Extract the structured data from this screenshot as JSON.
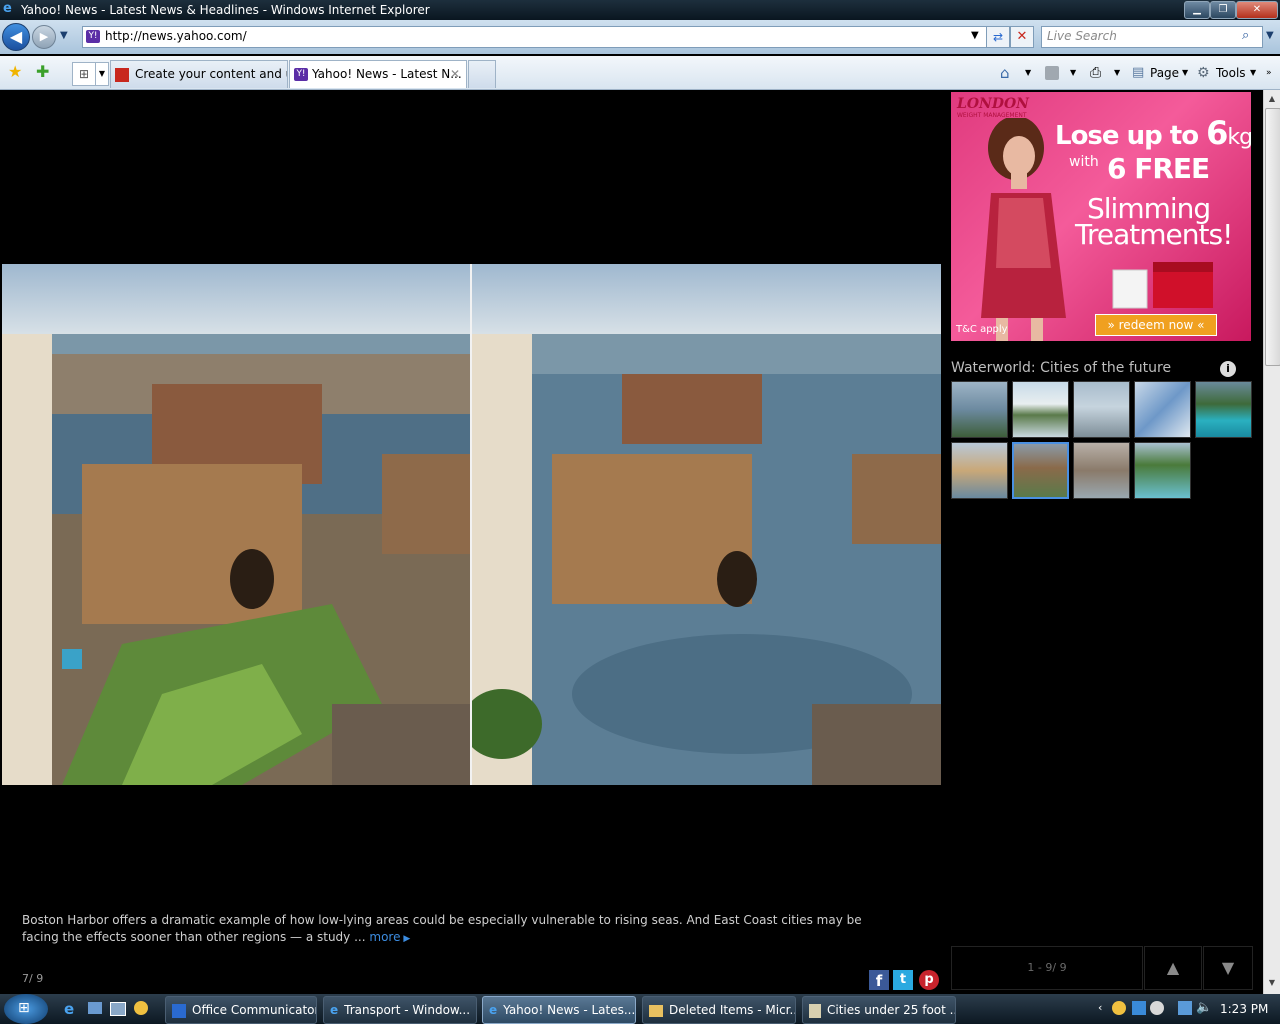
{
  "window": {
    "title": "Yahoo! News - Latest News & Headlines - Windows Internet Explorer"
  },
  "address_bar": {
    "url": "http://news.yahoo.com/",
    "search_placeholder": "Live Search"
  },
  "tabs": [
    {
      "label": "Create your content and u..."
    },
    {
      "label": "Yahoo! News - Latest N..."
    }
  ],
  "command_bar": {
    "page_label": "Page",
    "tools_label": "Tools"
  },
  "ad": {
    "brand": "LONDON",
    "brand_sub": "WEIGHT MANAGEMENT",
    "headline_1": "Lose up to",
    "headline_num": "6",
    "headline_unit": "kg",
    "with": "with",
    "free": "6 FREE",
    "treat_1": "Slimming",
    "treat_2": "Treatments!",
    "tc": "T&C apply",
    "cta": "» redeem now «"
  },
  "slideshow": {
    "title": "Waterworld: Cities of the future",
    "caption": "Boston Harbor offers a dramatic example of how low-lying areas could be especially vulnerable to rising seas. And East Coast cities may be facing the effects sooner than other regions — a study ...",
    "more": "more",
    "counter": "7/ 9",
    "range": "1 - 9/ 9"
  },
  "taskbar": {
    "tasks": [
      {
        "label": "Office Communicator"
      },
      {
        "label": "Transport - Window..."
      },
      {
        "label": "Yahoo! News - Lates..."
      },
      {
        "label": "Deleted Items - Micr..."
      },
      {
        "label": "Cities under 25 foot ..."
      }
    ],
    "clock": "1:23 PM"
  }
}
